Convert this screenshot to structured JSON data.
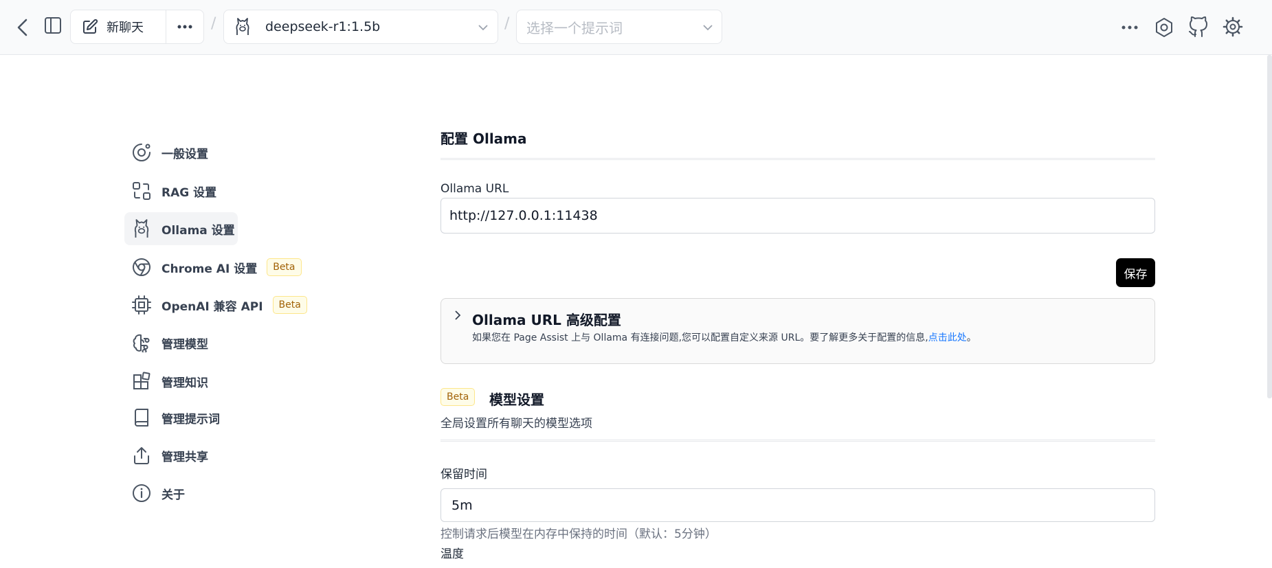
{
  "header": {
    "new_chat_label": "新聊天",
    "model_selected": "deepseek-r1:1.5b",
    "prompt_placeholder": "选择一个提示词",
    "separator": "/"
  },
  "sidebar": {
    "items": [
      {
        "label": "一般设置",
        "icon": "general-settings-icon"
      },
      {
        "label": "RAG 设置",
        "icon": "rag-icon"
      },
      {
        "label": "Ollama 设置",
        "icon": "ollama-icon",
        "active": true
      },
      {
        "label": "Chrome AI 设置",
        "icon": "chrome-icon",
        "badge": "Beta"
      },
      {
        "label": "OpenAI 兼容 API",
        "icon": "chip-icon",
        "badge": "Beta"
      },
      {
        "label": "管理模型",
        "icon": "brain-icon"
      },
      {
        "label": "管理知识",
        "icon": "blocks-icon"
      },
      {
        "label": "管理提示词",
        "icon": "book-icon"
      },
      {
        "label": "管理共享",
        "icon": "share-icon"
      },
      {
        "label": "关于",
        "icon": "info-icon"
      }
    ]
  },
  "main": {
    "section_title": "配置 Ollama",
    "url_label": "Ollama URL",
    "url_value": "http://127.0.0.1:11438",
    "save_label": "保存",
    "advanced": {
      "title": "Ollama URL 高级配置",
      "desc": "如果您在 Page Assist 上与 Ollama 有连接问题,您可以配置自定义来源 URL。要了解更多关于配置的信息,",
      "link": "点击此处",
      "desc_end": "。"
    },
    "model_settings": {
      "badge": "Beta",
      "title": "模型设置",
      "subtitle": "全局设置所有聊天的模型选项"
    },
    "keep_alive": {
      "label": "保留时间",
      "value": "5m",
      "help": "控制请求后模型在内存中保持的时间（默认：5分钟）"
    },
    "temperature_label": "温度"
  },
  "colors": {
    "accent_link": "#1677ff",
    "badge_bg": "#fefce8",
    "badge_border": "#fde68a",
    "save_button_bg": "#000000"
  }
}
